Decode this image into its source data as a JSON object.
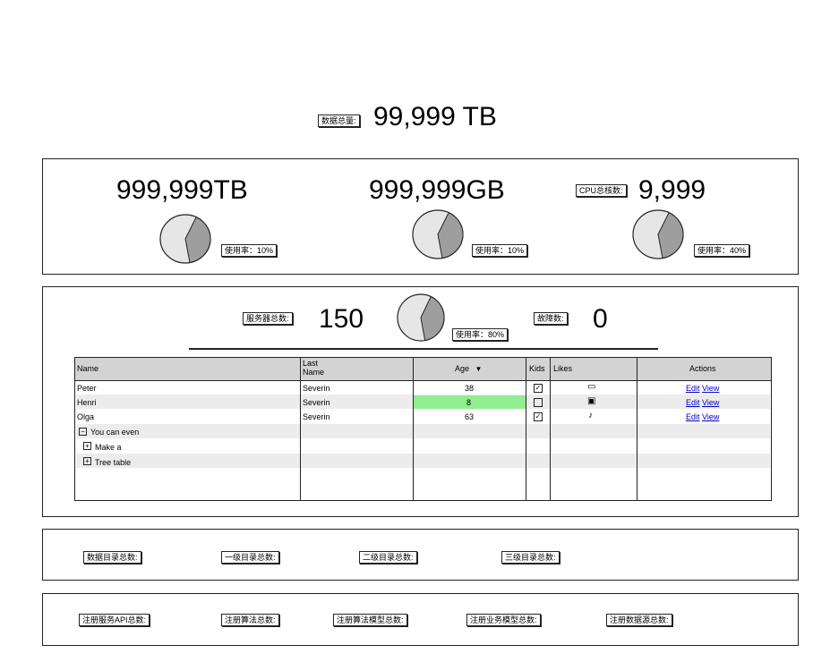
{
  "summary": {
    "data_total_label": "数据总量:",
    "data_total_value": "99,999 TB"
  },
  "storage_panel": {
    "disk": {
      "value": "999,999TB",
      "usage": "使用率：10%",
      "usage_fraction": 0.4
    },
    "memory": {
      "value": "999,999GB",
      "usage": "使用率：10%",
      "usage_fraction": 0.4
    },
    "cpu": {
      "label": "CPU总核数:",
      "value": "9,999",
      "usage": "使用率：40%",
      "usage_fraction": 0.4
    }
  },
  "server_panel": {
    "server_label": "服务器总数:",
    "server_value": "150",
    "usage": "使用率：80%",
    "usage_fraction": 0.4,
    "fault_label": "故障数:",
    "fault_value": "0"
  },
  "table": {
    "columns": [
      "Name",
      "Last Name",
      "Age",
      "Kids",
      "Likes",
      "Actions"
    ],
    "last_name_line1": "Last",
    "last_name_line2": "Name",
    "rows": [
      {
        "name": "Peter",
        "last": "Severin",
        "age": "38",
        "kids": true,
        "likes": "chat-icon",
        "edit": "Edit",
        "view": "View"
      },
      {
        "name": "Henri",
        "last": "Severin",
        "age": "8",
        "kids": false,
        "likes": "bus-icon",
        "edit": "Edit",
        "view": "View"
      },
      {
        "name": "Olga",
        "last": "Severin",
        "age": "63",
        "kids": true,
        "likes": "music-note-icon",
        "edit": "Edit",
        "view": "View"
      }
    ],
    "tree": [
      {
        "label": "You can even",
        "toggle": "−"
      },
      {
        "label": "Make a",
        "toggle": "+"
      },
      {
        "label": "Tree table",
        "toggle": "+"
      }
    ],
    "highlight_color": "#90ee90"
  },
  "catalog_panel": {
    "labels": [
      "数据目录总数:",
      "一级目录总数:",
      "二级目录总数:",
      "三级目录总数:"
    ]
  },
  "registry_panel": {
    "labels": [
      "注册服务API总数:",
      "注册算法总数:",
      "注册算法模型总数:",
      "注册业务模型总数:",
      "注册数据源总数:"
    ]
  }
}
